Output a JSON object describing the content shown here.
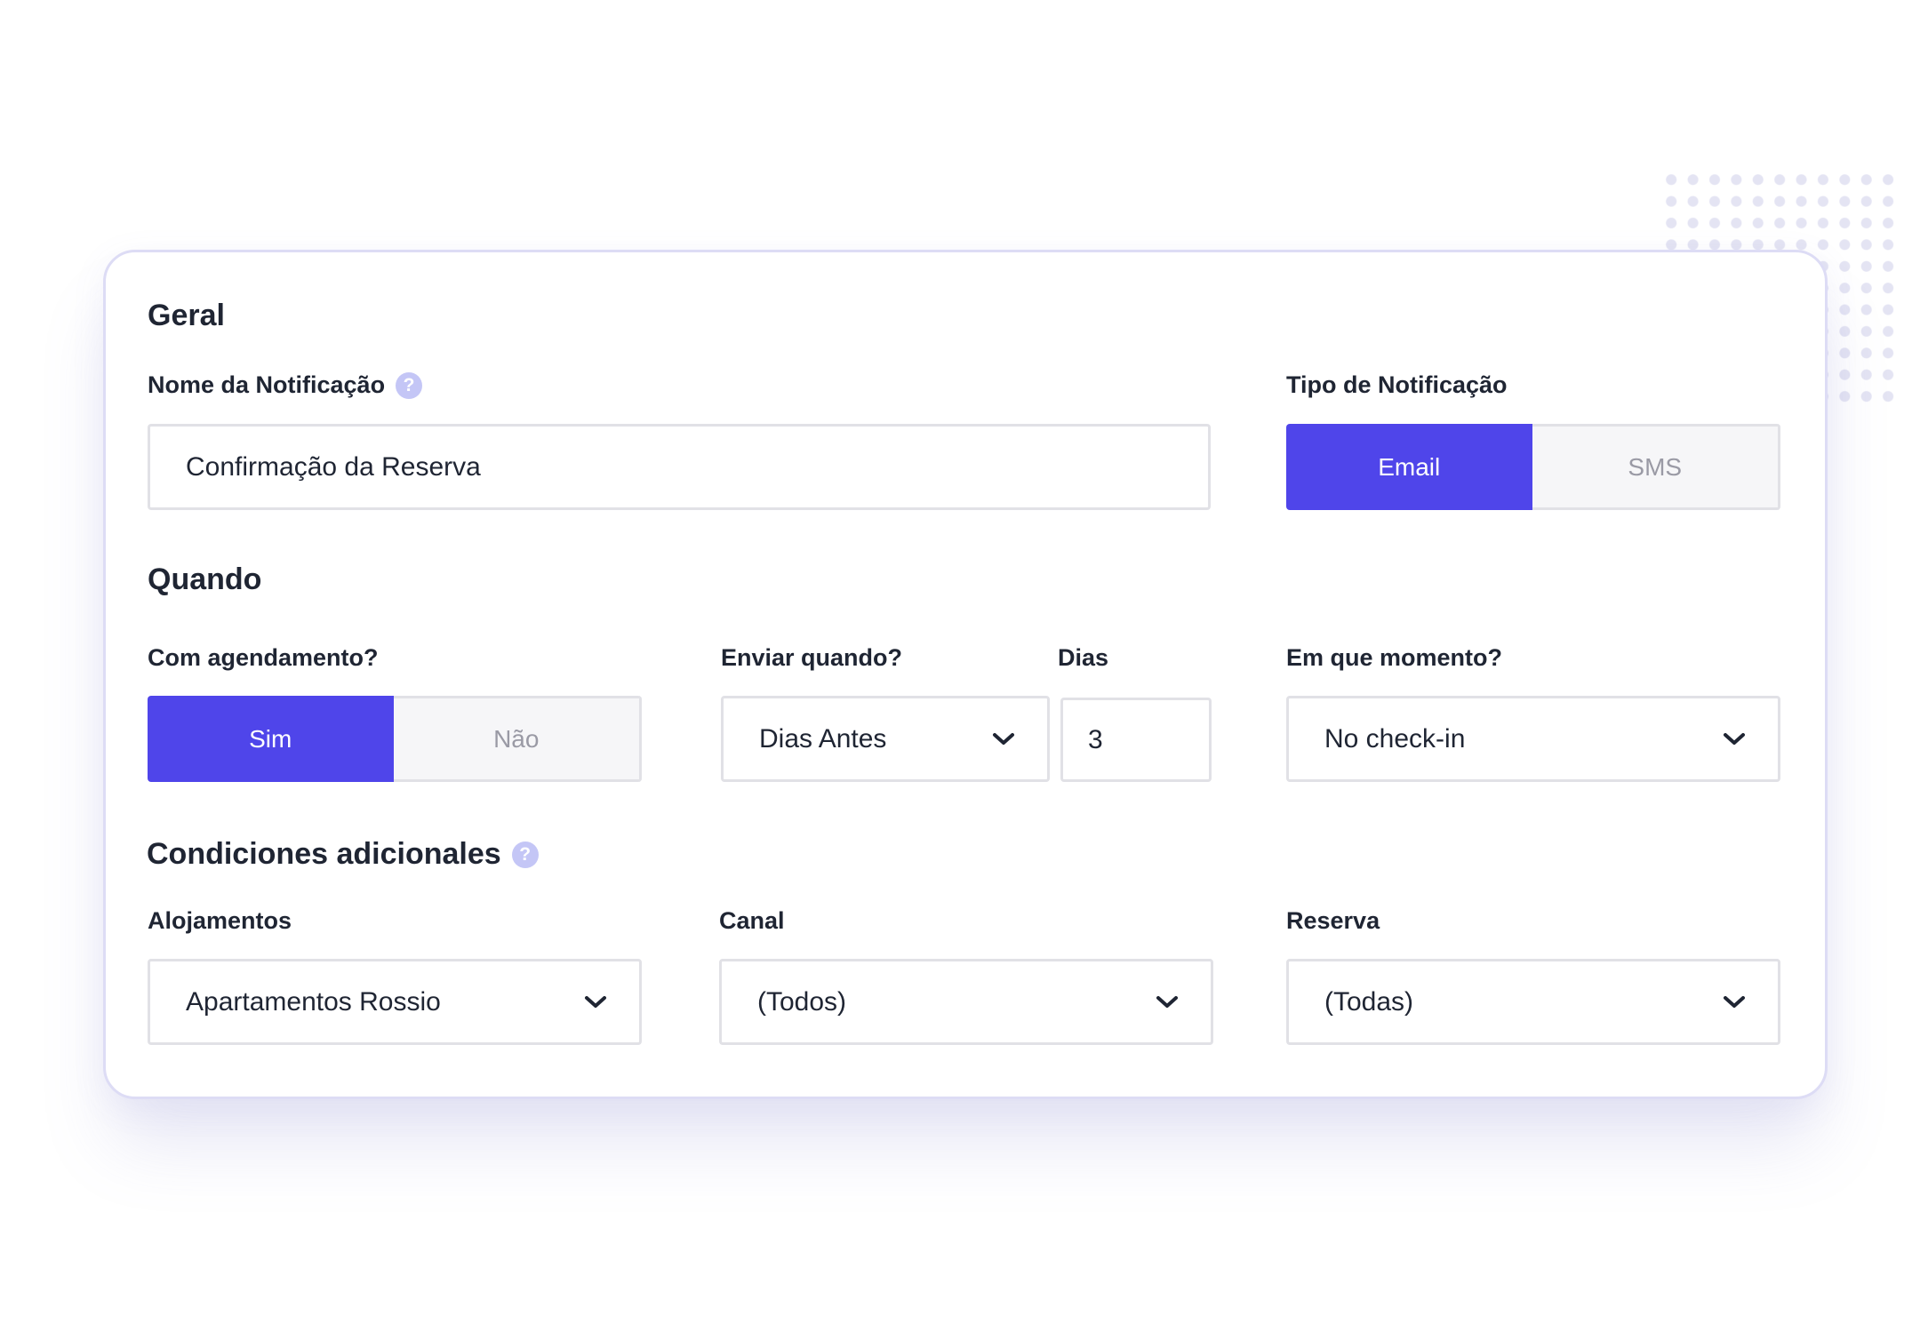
{
  "colors": {
    "accent": "#4f45ea",
    "help_icon": "#c4c6f6",
    "border": "#e1e1e6",
    "card_border": "#dddcf5"
  },
  "general": {
    "title": "Geral",
    "notification_name": {
      "label": "Nome da Notificação",
      "help_icon": "question-mark",
      "value": "Confirmação da Reserva"
    },
    "notification_type": {
      "label": "Tipo de Notificação",
      "options": [
        "Email",
        "SMS"
      ],
      "selected": "Email"
    }
  },
  "when": {
    "title": "Quando",
    "scheduled": {
      "label": "Com agendamento?",
      "options": [
        "Sim",
        "Não"
      ],
      "selected": "Sim"
    },
    "send_when": {
      "label": "Enviar quando?",
      "value": "Dias Antes"
    },
    "days": {
      "label": "Dias",
      "value": "3"
    },
    "moment": {
      "label": "Em que momento?",
      "value": "No check-in"
    }
  },
  "conditions": {
    "title": "Condiciones adicionales",
    "help_icon": "question-mark",
    "lodging": {
      "label": "Alojamentos",
      "value": "Apartamentos Rossio"
    },
    "channel": {
      "label": "Canal",
      "value": "(Todos)"
    },
    "reservation": {
      "label": "Reserva",
      "value": "(Todas)"
    }
  }
}
